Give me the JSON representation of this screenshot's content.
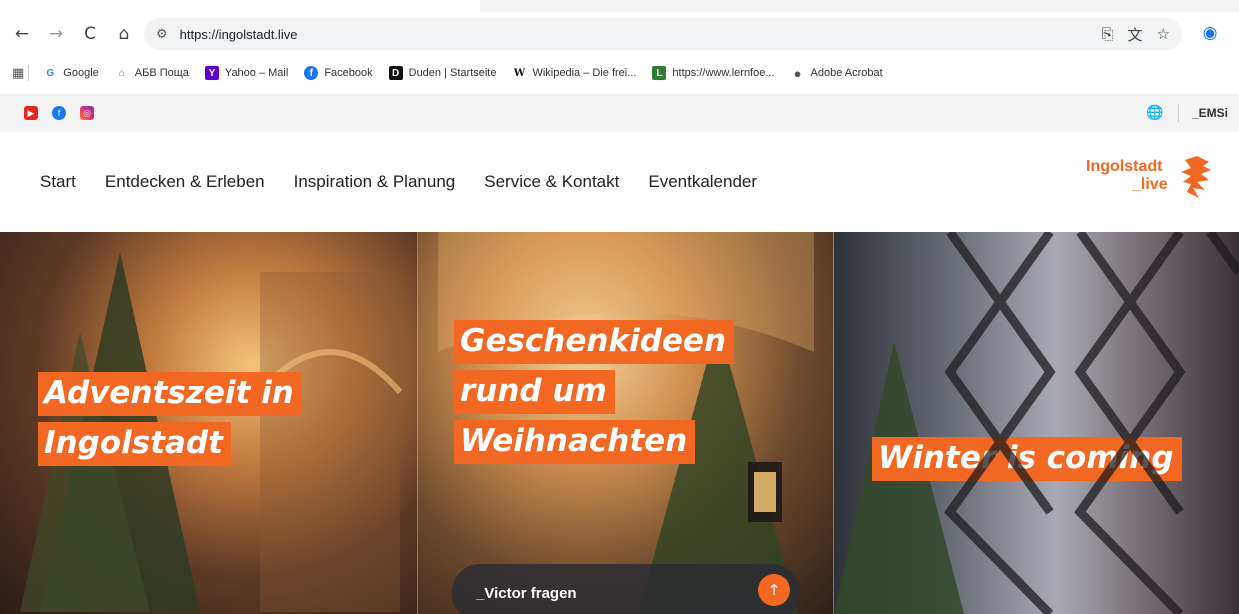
{
  "browser": {
    "url": "https://ingolstadt.live",
    "nav_icons": {
      "back": "←",
      "forward": "→",
      "reload": "C",
      "home": "⌂",
      "site_settings": "⚙"
    },
    "toolbar_icons": {
      "cast": "⎘",
      "translate": "文",
      "bookmark": "☆",
      "profile": "◉"
    },
    "bookmarks": [
      {
        "label": "Google",
        "icon": "G",
        "color": "#4285f4"
      },
      {
        "label": "АБВ Поща",
        "icon": "⌂",
        "color": "#34a853"
      },
      {
        "label": "Yahoo – Mail",
        "icon": "Y",
        "color": "#5f01d1"
      },
      {
        "label": "Facebook",
        "icon": "f",
        "color": "#1877f2"
      },
      {
        "label": "Duden | Startseite",
        "icon": "D",
        "color": "#111111"
      },
      {
        "label": "Wikipedia – Die frei...",
        "icon": "W",
        "color": "#ffffff"
      },
      {
        "label": "https://www.lernfoe...",
        "icon": "L",
        "color": "#2e7d32"
      },
      {
        "label": "Adobe Acrobat",
        "icon": "●",
        "color": "#555555"
      }
    ]
  },
  "topbar": {
    "social": [
      "youtube-icon",
      "facebook-icon",
      "instagram-icon"
    ],
    "lang_icon": "🌐",
    "label": "_EMSi"
  },
  "site": {
    "nav": [
      "Start",
      "Entdecken & Erleben",
      "Inspiration & Planung",
      "Service & Kontakt",
      "Eventkalender"
    ],
    "logo_line1": "Ingolstadt",
    "logo_line2": "_live",
    "accent": "#f26722"
  },
  "hero": {
    "panel1": [
      "Adventszeit in",
      "Ingolstadt"
    ],
    "panel2": [
      "Geschenkideen",
      "rund um",
      "Weihnachten"
    ],
    "panel3": [
      "Winter is coming"
    ],
    "chat_label": "_Victor fragen",
    "chat_button": "↑"
  }
}
